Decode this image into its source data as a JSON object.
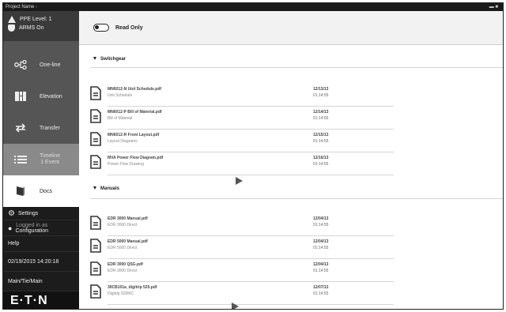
{
  "window": {
    "title": "Project Name -",
    "controls": ""
  },
  "sidebar": {
    "ppe_level": "PPE Level: 1",
    "arms": "ARMS On",
    "nav": [
      {
        "label": "One-line",
        "icon": "one-line-icon"
      },
      {
        "label": "Elevation",
        "icon": "elevation-icon"
      },
      {
        "label": "Transfer",
        "icon": "transfer-icon"
      },
      {
        "label": "Timeline",
        "sublabel": "1 Event",
        "icon": "timeline-icon"
      },
      {
        "label": "Docs",
        "icon": "docs-icon"
      }
    ],
    "settings": "Settings",
    "login_line1": "Logged in as",
    "login_line2": "Configuration",
    "help": "Help",
    "datetime": "02/19/2015 14:20:18",
    "main_tie": "Main/Tie/Main",
    "logo": "E·T·N"
  },
  "main": {
    "read_only_label": "Read Only",
    "sections": [
      {
        "title": "Switchgear",
        "docs": [
          {
            "name": "MN6012-N Unit Schedule.pdf",
            "type": "Unit Schedule",
            "date": "12/13/13",
            "time": "01:14:55"
          },
          {
            "name": "MN6012-P Bill of Material.pdf",
            "type": "Bill of Material",
            "date": "12/14/13",
            "time": "01:14:55"
          },
          {
            "name": "MN6012-R Front Layout.pdf",
            "type": "Layout Diagrams",
            "date": "12/15/13",
            "time": "01:14:55"
          },
          {
            "name": "MVA Power Flow Diagram.pdf",
            "type": "Power Flow Drawing",
            "date": "12/16/13",
            "time": "01:14:55"
          }
        ]
      },
      {
        "title": "Manuals",
        "docs": [
          {
            "name": "EDR 3000 Manual.pdf",
            "type": "EDR 3000 Direct",
            "date": "12/04/13",
            "time": "01:14:55"
          },
          {
            "name": "EDR 5000 Manual.pdf",
            "type": "EDR 5000 Direct",
            "date": "12/04/13",
            "time": "01:14:55"
          },
          {
            "name": "EDR 3000 QSG.pdf",
            "type": "EDR 3000 Direct",
            "date": "12/04/13",
            "time": "01:14:55"
          },
          {
            "name": "30CB101a_digitrip 520.pdf",
            "type": "Digitrip 520MC",
            "date": "12/07/13",
            "time": "01:14:55"
          }
        ]
      }
    ]
  },
  "colors": {
    "sidebar": "#555555",
    "bottom_panel": "#1c1c1c",
    "timeline_highlight": "#8a8a8a",
    "accent_text": "#222222"
  }
}
